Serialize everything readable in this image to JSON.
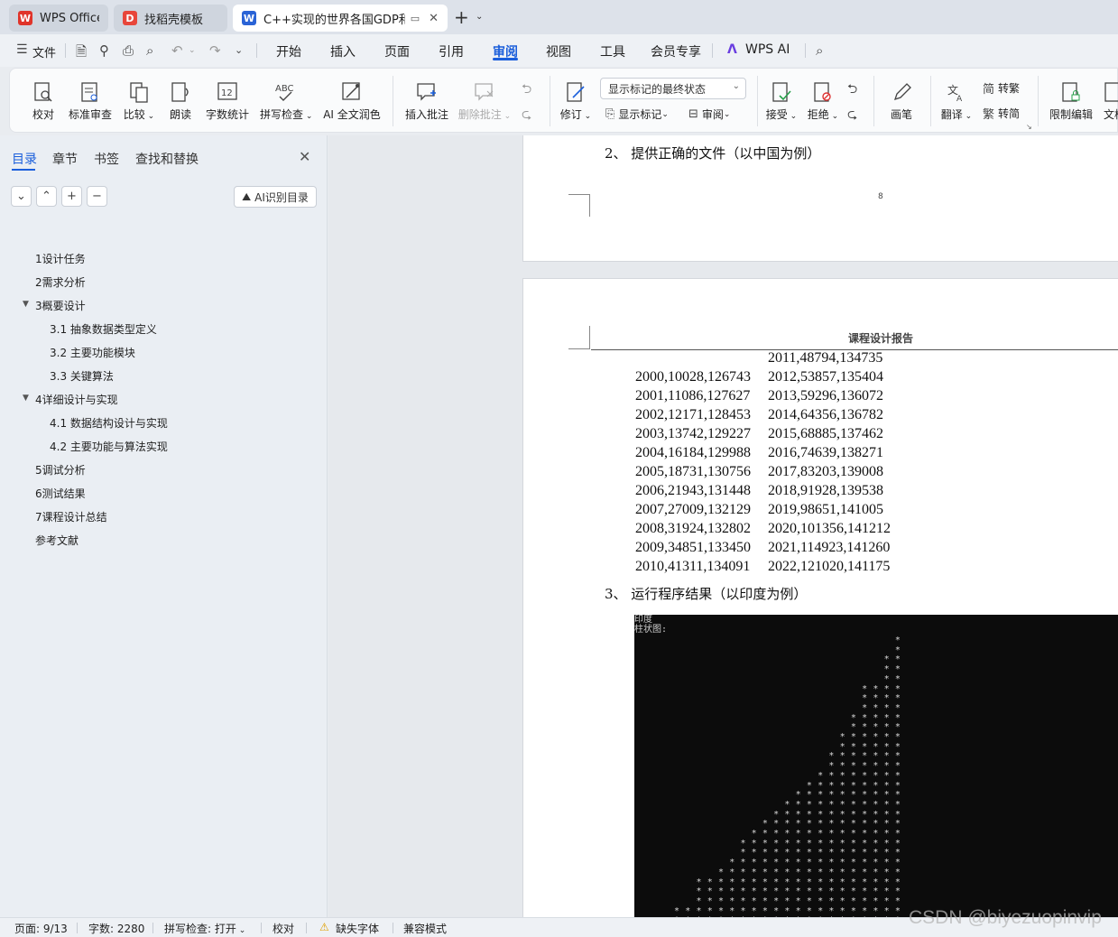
{
  "tabs": [
    {
      "label": "WPS Office",
      "icon": "wps-logo-icon"
    },
    {
      "label": "找稻壳模板",
      "icon": "docer-icon"
    },
    {
      "label": "C++实现的世界各国GDP和人",
      "icon": "writer-doc-icon"
    }
  ],
  "menu": {
    "file": "文件",
    "items": [
      "开始",
      "插入",
      "页面",
      "引用",
      "审阅",
      "视图",
      "工具",
      "会员专享"
    ],
    "active": "审阅",
    "wps_ai": "WPS AI"
  },
  "ribbon": {
    "proofread": "校对",
    "std_review": "标准审查",
    "compare": "比较",
    "read_aloud": "朗读",
    "word_count": "字数统计",
    "spell_check": "拼写检查",
    "ai_polish": "AI 全文润色",
    "insert_comment": "插入批注",
    "delete_comment": "删除批注",
    "markup_dropdown": "显示标记的最终状态",
    "track_changes": "修订",
    "show_markup": "显示标记",
    "review": "审阅",
    "accept": "接受",
    "reject": "拒绝",
    "pen": "画笔",
    "translate": "翻译",
    "to_traditional": "转繁",
    "to_simplified": "转简",
    "restrict_edit": "限制编辑",
    "doc": "文档"
  },
  "panel": {
    "tabs": [
      "目录",
      "章节",
      "书签",
      "查找和替换"
    ],
    "ai_toc": "AI识别目录",
    "toc": [
      {
        "label": "1设计任务",
        "level": 1
      },
      {
        "label": "2需求分析",
        "level": 1
      },
      {
        "label": "3概要设计",
        "level": 1,
        "expanded": true
      },
      {
        "label": "3.1 抽象数据类型定义",
        "level": 2
      },
      {
        "label": "3.2  主要功能模块",
        "level": 2
      },
      {
        "label": "3.3  关键算法",
        "level": 2
      },
      {
        "label": "4详细设计与实现",
        "level": 1,
        "expanded": true
      },
      {
        "label": "4.1  数据结构设计与实现",
        "level": 2
      },
      {
        "label": "4.2  主要功能与算法实现",
        "level": 2
      },
      {
        "label": "5调试分析",
        "level": 1
      },
      {
        "label": "6测试结果",
        "level": 1
      },
      {
        "label": "7课程设计总结",
        "level": 1
      },
      {
        "label": "参考文献",
        "level": 1
      }
    ]
  },
  "document": {
    "section2": "2、  提供正确的文件（以中国为例）",
    "page_number": "8",
    "header_title": "课程设计报告",
    "right_first": "2011,48794,134735",
    "rows": [
      [
        "2000,10028,126743",
        "2012,53857,135404"
      ],
      [
        "2001,11086,127627",
        "2013,59296,136072"
      ],
      [
        "2002,12171,128453",
        "2014,64356,136782"
      ],
      [
        "2003,13742,129227",
        "2015,68885,137462"
      ],
      [
        "2004,16184,129988",
        "2016,74639,138271"
      ],
      [
        "2005,18731,130756",
        "2017,83203,139008"
      ],
      [
        "2006,21943,131448",
        "2018,91928,139538"
      ],
      [
        "2007,27009,132129",
        "2019,98651,141005"
      ],
      [
        "2008,31924,132802",
        "2020,101356,141212"
      ],
      [
        "2009,34851,133450",
        "2021,114923,141260"
      ],
      [
        "2010,41311,134091",
        "2022,121020,141175"
      ]
    ],
    "section3": "3、  运行程序结果（以印度为例）",
    "console_line1": "印度",
    "console_line2": "柱状图:"
  },
  "status": {
    "page": "页面: 9/13",
    "words": "字数: 2280",
    "spell": "拼写检查: 打开",
    "proof": "校对",
    "missing_font": "缺失字体",
    "compat": "兼容模式"
  },
  "watermark": "CSDN @biyezuopinvip",
  "colors": {
    "accent": "#1a5edb",
    "console_bg": "#0c0c0c"
  }
}
